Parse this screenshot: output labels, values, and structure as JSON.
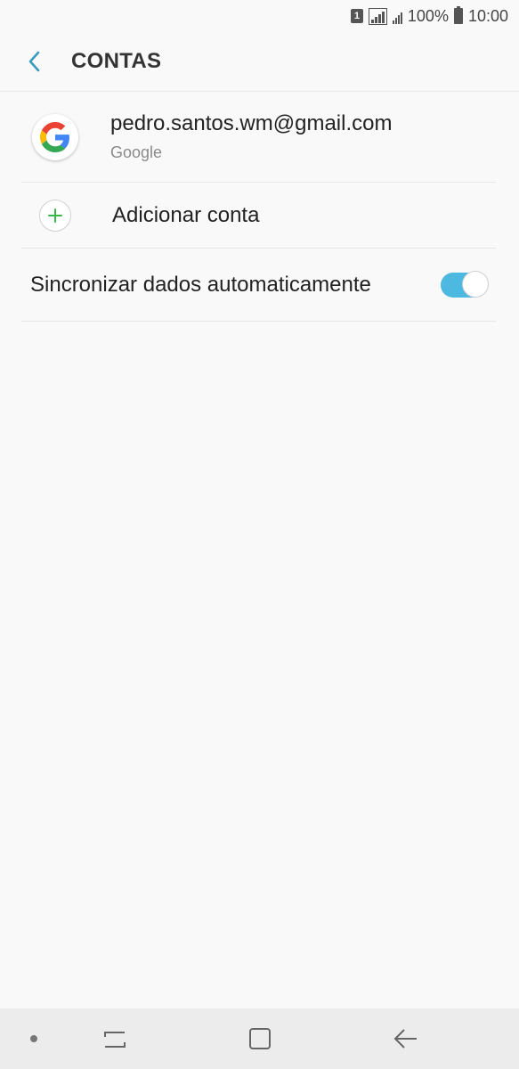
{
  "status_bar": {
    "sim": "1",
    "battery_percent": "100%",
    "time": "10:00"
  },
  "header": {
    "title": "CONTAS",
    "back_icon": "chevron-left-icon"
  },
  "account": {
    "email": "pedro.santos.wm@gmail.com",
    "type": "Google",
    "icon": "google-icon"
  },
  "add_account": {
    "label": "Adicionar conta",
    "icon": "plus-icon"
  },
  "sync": {
    "label": "Sincronizar dados automaticamente",
    "enabled": true
  },
  "nav_bar": {
    "icons": [
      "dot-icon",
      "recents-icon",
      "home-icon",
      "back-arrow-icon"
    ]
  },
  "colors": {
    "accent": "#4db8e0",
    "back_chevron": "#3a9bbd",
    "plus_green": "#3cb64c",
    "background": "#f9f9f9"
  }
}
